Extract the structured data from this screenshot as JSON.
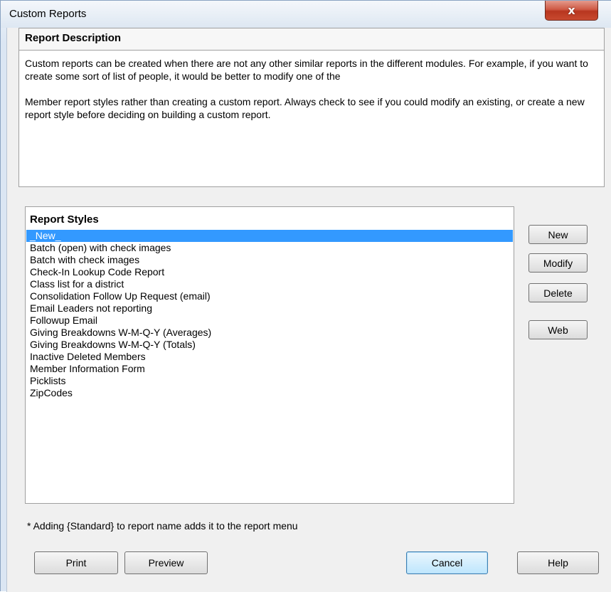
{
  "window": {
    "title": "Custom Reports",
    "close_glyph": "x"
  },
  "description": {
    "heading": "Report Description",
    "paragraph1": "Custom reports can be created when there are not any other similar reports in the different modules.  For example, if you want to create some sort of list of people, it would be better to modify one of the",
    "paragraph2": "Member report styles rather than creating a custom report.  Always check to see if you could modify an existing, or create a new report style before deciding on building a custom report."
  },
  "styles": {
    "heading": "Report Styles",
    "items": [
      "_New_",
      "Batch (open) with check images",
      "Batch with check images",
      "Check-In Lookup Code Report",
      "Class list for a district",
      "Consolidation Follow Up Request (email)",
      "Email Leaders not reporting",
      "Followup Email",
      "Giving Breakdowns W-M-Q-Y (Averages)",
      "Giving Breakdowns W-M-Q-Y (Totals)",
      "Inactive Deleted Members",
      "Member Information Form",
      "Picklists",
      "ZipCodes"
    ],
    "selected_index": 0
  },
  "side_buttons": {
    "new": "New",
    "modify": "Modify",
    "delete": "Delete",
    "web": "Web"
  },
  "footnote": "* Adding {Standard} to report name adds it to the report menu",
  "bottom_buttons": {
    "print": "Print",
    "preview": "Preview",
    "cancel": "Cancel",
    "help": "Help"
  },
  "colors": {
    "selection": "#3399ff",
    "close_button": "#c84a30"
  }
}
